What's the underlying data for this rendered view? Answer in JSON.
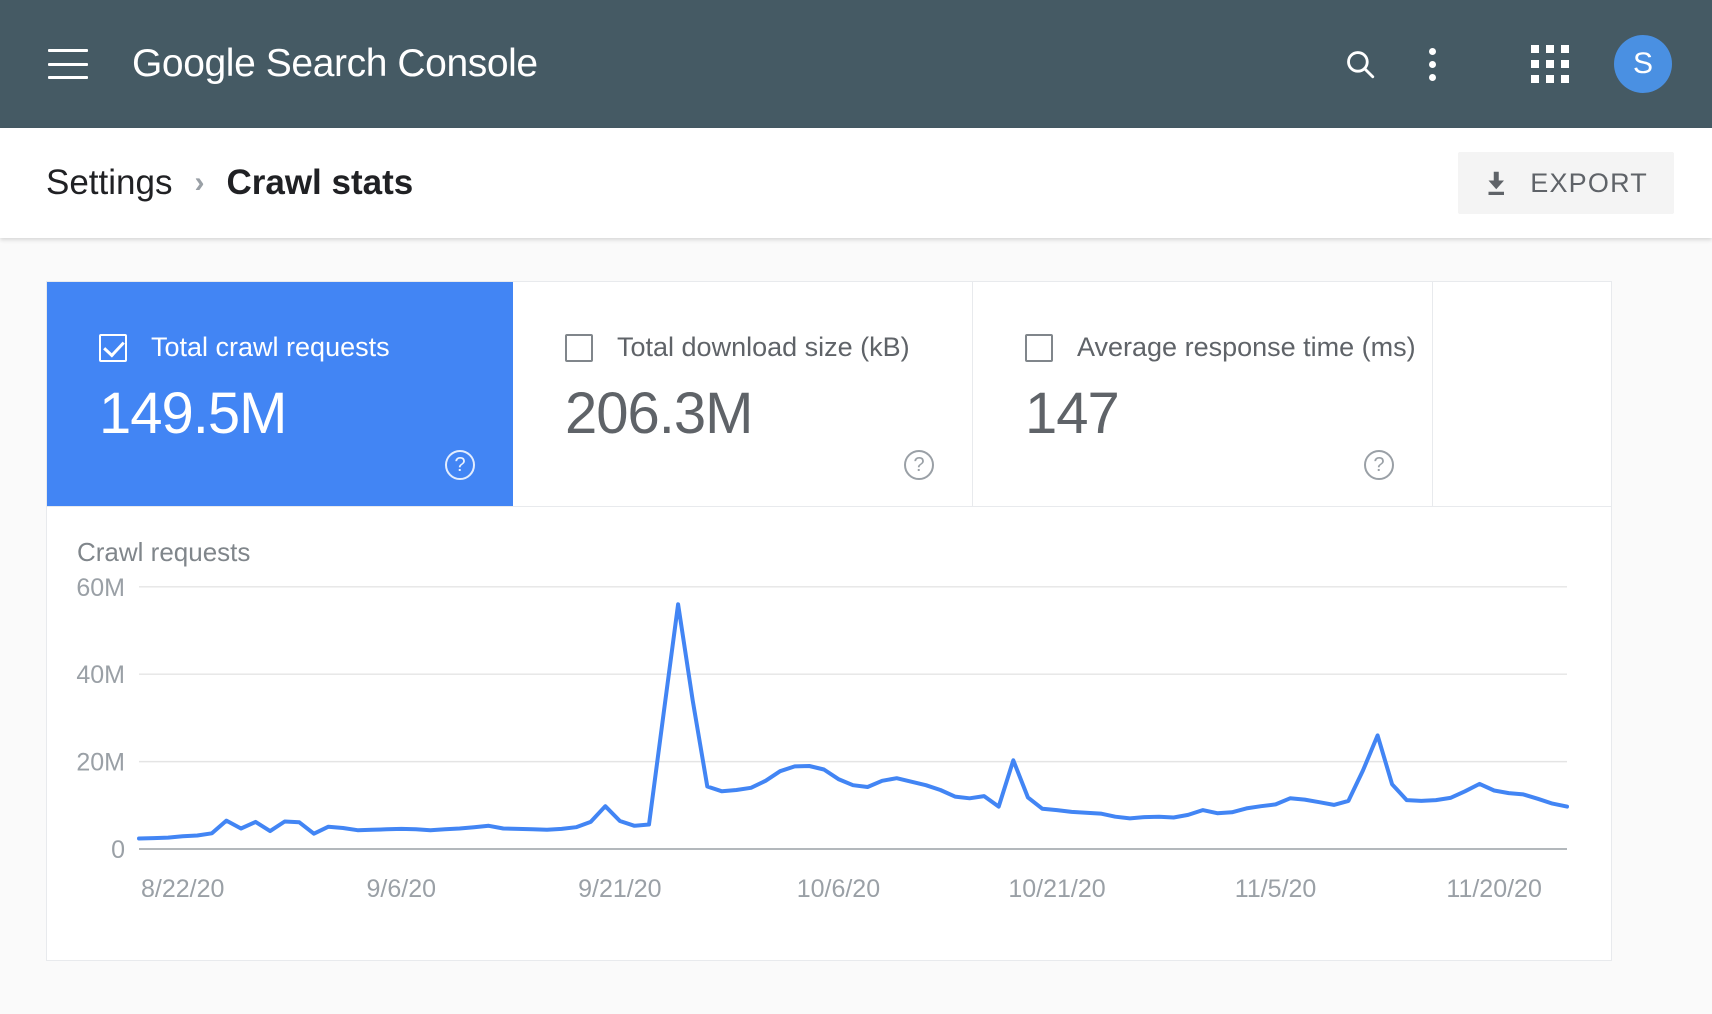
{
  "topbar": {
    "menu_icon": "hamburger-icon",
    "brand_bold": "Google",
    "brand_rest": " Search Console",
    "search_icon": "search-icon",
    "overflow_icon": "more-vert-icon",
    "apps_icon": "apps-grid-icon",
    "avatar_initial": "S",
    "background": "#455a64"
  },
  "breadcrumb": {
    "parent": "Settings",
    "separator": "›",
    "current": "Crawl stats",
    "export_label": "EXPORT",
    "export_icon": "download-icon"
  },
  "metrics": [
    {
      "label": "Total crawl requests",
      "value": "149.5M",
      "checked": true,
      "selected": true,
      "help_icon": "help-circle-icon",
      "accent": "#4285f4"
    },
    {
      "label": "Total download size (kB)",
      "value": "206.3M",
      "checked": false,
      "selected": false,
      "help_icon": "help-circle-icon"
    },
    {
      "label": "Average response time (ms)",
      "value": "147",
      "checked": false,
      "selected": false,
      "help_icon": "help-circle-icon"
    }
  ],
  "chart_data": {
    "type": "line",
    "title": "Crawl requests",
    "xlabel": "",
    "ylabel": "Crawl requests",
    "ylim": [
      0,
      65000000
    ],
    "ytick_labels": [
      "0",
      "20M",
      "40M",
      "60M"
    ],
    "ytick_values": [
      0,
      20000000,
      40000000,
      60000000
    ],
    "xtick_labels": [
      "8/22/20",
      "9/6/20",
      "9/21/20",
      "10/6/20",
      "10/21/20",
      "11/5/20",
      "11/20/20"
    ],
    "xtick_indices": [
      3,
      18,
      33,
      48,
      63,
      78,
      93
    ],
    "grid": true,
    "legend": "none",
    "line_color": "#4285f4",
    "series": [
      {
        "name": "Crawl requests",
        "values": [
          2400000,
          2500000,
          2600000,
          2900000,
          3100000,
          3600000,
          6500000,
          4700000,
          6200000,
          4100000,
          6300000,
          6100000,
          3500000,
          5100000,
          4800000,
          4300000,
          4400000,
          4500000,
          4600000,
          4500000,
          4300000,
          4500000,
          4700000,
          5000000,
          5300000,
          4700000,
          4600000,
          4500000,
          4400000,
          4600000,
          5000000,
          6200000,
          9800000,
          6400000,
          5300000,
          5600000,
          31000000,
          56000000,
          34000000,
          14300000,
          13200000,
          13500000,
          14000000,
          15600000,
          17800000,
          18900000,
          19000000,
          18200000,
          16000000,
          14600000,
          14200000,
          15600000,
          16200000,
          15400000,
          14600000,
          13500000,
          12000000,
          11600000,
          12100000,
          9700000,
          20300000,
          11800000,
          9200000,
          8900000,
          8500000,
          8300000,
          8100000,
          7400000,
          7000000,
          7300000,
          7400000,
          7200000,
          7800000,
          8900000,
          8200000,
          8400000,
          9300000,
          9800000,
          10200000,
          11600000,
          11300000,
          10700000,
          10100000,
          11000000,
          18000000,
          26000000,
          14800000,
          11200000,
          11000000,
          11200000,
          11700000,
          13200000,
          14900000,
          13400000,
          12800000,
          12500000,
          11500000,
          10400000,
          9700000
        ]
      }
    ]
  }
}
